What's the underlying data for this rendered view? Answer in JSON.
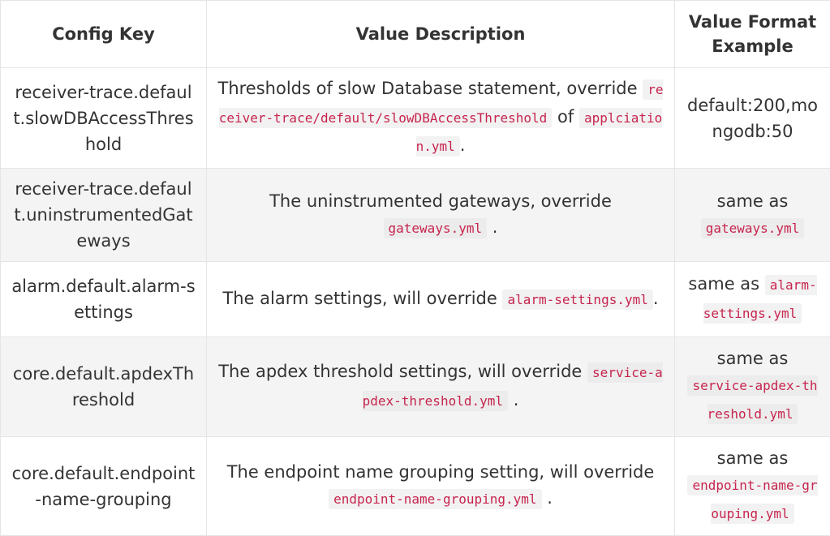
{
  "headers": {
    "config_key": "Config Key",
    "value_description": "Value Description",
    "value_format_example": "Value Format Example"
  },
  "rows": [
    {
      "key": "receiver-trace.default.slowDBAccessThreshold",
      "desc_text_1": "Thresholds of slow Database statement, override",
      "desc_code_1": "receiver-trace/default/slowDBAccessThreshold",
      "desc_text_2": "of",
      "desc_code_2": "applciation.yml",
      "desc_text_3": ".",
      "example_text": "default:200,mongodb:50"
    },
    {
      "key": "receiver-trace.default.uninstrumentedGateways",
      "desc_text_1": "The uninstrumented gateways, override",
      "desc_code_1": "gateways.yml",
      "desc_text_2": ".",
      "example_text": "same as",
      "example_code": "gateways.yml"
    },
    {
      "key": "alarm.default.alarm-settings",
      "desc_text_1": "The alarm settings, will override",
      "desc_code_1": "alarm-settings.yml",
      "desc_text_2": ".",
      "example_text": "same as",
      "example_code": "alarm-settings.yml"
    },
    {
      "key": "core.default.apdexThreshold",
      "desc_text_1": "The apdex threshold settings, will override",
      "desc_code_1": "service-apdex-threshold.yml",
      "desc_text_2": ".",
      "example_text": "same as",
      "example_code": "service-apdex-threshold.yml"
    },
    {
      "key": "core.default.endpoint-name-grouping",
      "desc_text_1": "The endpoint name grouping setting, will override",
      "desc_code_1": "endpoint-name-grouping.yml",
      "desc_text_2": ".",
      "example_text": "same as",
      "example_code": "endpoint-name-grouping.yml"
    }
  ]
}
